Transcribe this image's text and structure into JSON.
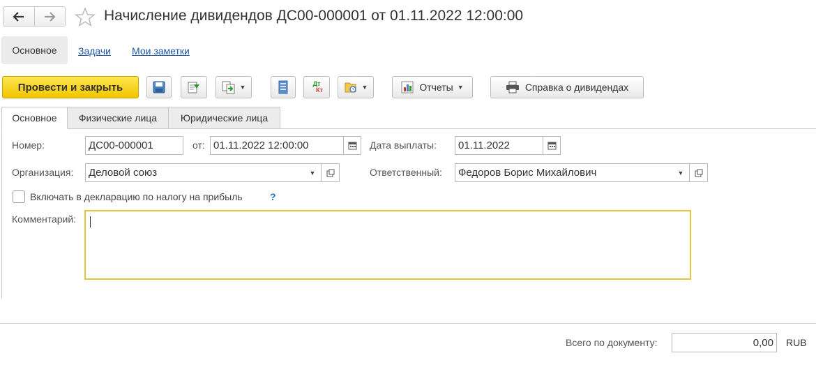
{
  "header": {
    "back_icon": "arrow-left-icon",
    "forward_icon": "arrow-right-icon",
    "favorite_icon": "star-icon",
    "title": "Начисление дивидендов ДС00-000001 от 01.11.2022 12:00:00"
  },
  "page_nav": {
    "items": [
      "Основное",
      "Задачи",
      "Мои заметки"
    ],
    "active": "Основное"
  },
  "toolbar": {
    "post_and_close": "Провести и закрыть",
    "reports": "Отчеты",
    "dividend_certificate": "Справка о дивидендах",
    "dt_label": "Дт",
    "kt_label": "Кт",
    "icons": [
      "save-icon",
      "post-icon",
      "create-based-on-icon",
      "list-icon",
      "dt-kt-icon",
      "attachments-icon",
      "reports-icon",
      "printer-icon"
    ]
  },
  "form_tabs": {
    "items": [
      "Основное",
      "Физические лица",
      "Юридические лица"
    ],
    "active": "Основное"
  },
  "form": {
    "number_label": "Номер:",
    "number_value": "ДС00-000001",
    "from_label": "от:",
    "date_value": "01.11.2022 12:00:00",
    "payment_date_label": "Дата выплаты:",
    "payment_date_value": "01.11.2022",
    "organization_label": "Организация:",
    "organization_value": "Деловой союз",
    "responsible_label": "Ответственный:",
    "responsible_value": "Федоров Борис Михайлович",
    "declaration_label": "Включать в декларацию по налогу на прибыль",
    "declaration_checked": false,
    "help": "?",
    "comment_label": "Комментарий:",
    "comment_value": ""
  },
  "footer": {
    "total_label": "Всего по документу:",
    "total_value": "0,00",
    "currency": "RUB"
  },
  "colors": {
    "primary_button": "#f5d000",
    "link": "#1c55a4",
    "focus_border": "#e6c33d"
  }
}
